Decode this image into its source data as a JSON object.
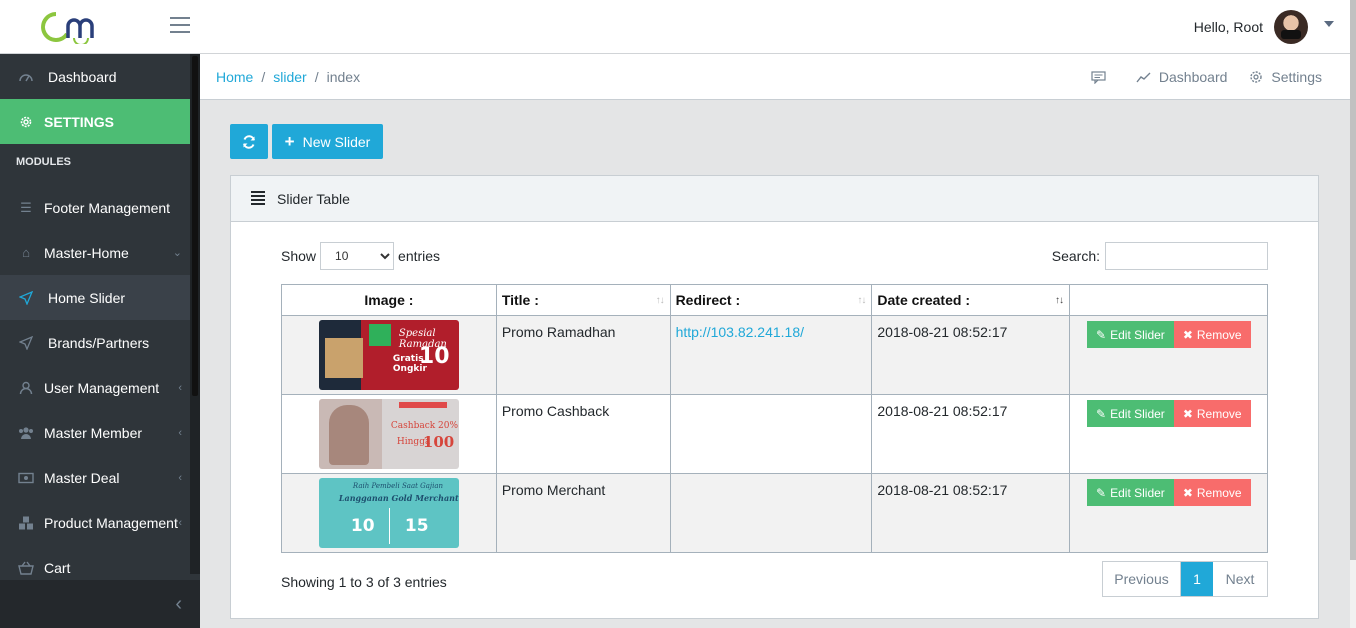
{
  "header": {
    "greeting": "Hello, Root"
  },
  "breadcrumb": {
    "home": "Home",
    "section": "slider",
    "current": "index",
    "sep": "/"
  },
  "breadcrumb_menu": {
    "dashboard": "Dashboard",
    "settings": "Settings"
  },
  "sidebar": {
    "dashboard": "Dashboard",
    "settings": "SETTINGS",
    "modules_title": "MODULES",
    "items": [
      {
        "label": "Footer Management",
        "icon": "list-icon"
      },
      {
        "label": "Master-Home",
        "icon": "home-icon"
      },
      {
        "label": "Home Slider",
        "icon": "paper-plane-icon"
      },
      {
        "label": "Brands/Partners",
        "icon": "paper-plane-icon"
      },
      {
        "label": "User Management",
        "icon": "user-icon"
      },
      {
        "label": "Master Member",
        "icon": "users-icon"
      },
      {
        "label": "Master Deal",
        "icon": "money-icon"
      },
      {
        "label": "Product Management",
        "icon": "cubes-icon"
      },
      {
        "label": "Cart",
        "icon": "basket-icon"
      }
    ]
  },
  "toolbar": {
    "new_label": "New Slider"
  },
  "card": {
    "title": "Slider Table"
  },
  "table_controls": {
    "show": "Show",
    "entries": "entries",
    "page_size": "10",
    "search": "Search:"
  },
  "columns": {
    "image": "Image :",
    "title": "Title :",
    "redirect": "Redirect :",
    "date": "Date created :"
  },
  "rows": [
    {
      "title": "Promo Ramadhan",
      "redirect": "http://103.82.241.18/",
      "date": "2018-08-21 08:52:17",
      "thumb": {
        "line1": "Spesial Ramadan",
        "line2": "Gratis Ongkir",
        "value": "10"
      }
    },
    {
      "title": "Promo Cashback",
      "redirect": "",
      "date": "2018-08-21 08:52:17",
      "thumb": {
        "line1": "Cashback 20%",
        "line2": "Hingga",
        "value": "100"
      }
    },
    {
      "title": "Promo Merchant",
      "redirect": "",
      "date": "2018-08-21 08:52:17",
      "thumb": {
        "line1": "Raih Pembeli Saat Gajian",
        "line2": "Langganan Gold Merchant",
        "value": "10",
        "value2": "15"
      }
    }
  ],
  "row_actions": {
    "edit": "Edit Slider",
    "remove": "Remove"
  },
  "footer": {
    "info": "Showing 1 to 3 of 3 entries",
    "previous": "Previous",
    "page": "1",
    "next": "Next"
  },
  "colors": {
    "primary": "#20a8d8",
    "success": "#4dbd74",
    "danger": "#f86c6b",
    "sidebar": "#2f353a"
  }
}
